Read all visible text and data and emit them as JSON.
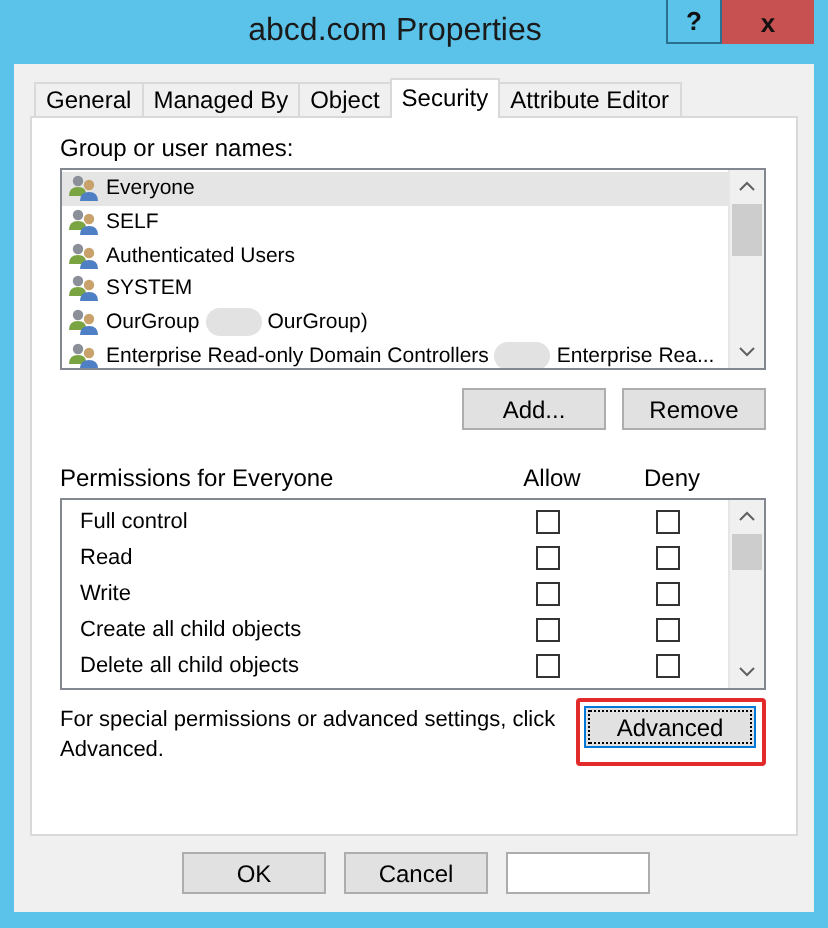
{
  "window": {
    "title": "abcd.com Properties",
    "help_button": "?",
    "close_button": "x"
  },
  "tabs": [
    {
      "label": "General",
      "selected": false
    },
    {
      "label": "Managed By",
      "selected": false
    },
    {
      "label": "Object",
      "selected": false
    },
    {
      "label": "Security",
      "selected": true
    },
    {
      "label": "Attribute Editor",
      "selected": false
    }
  ],
  "groups": {
    "label": "Group or user names:",
    "items": [
      {
        "name": "Everyone",
        "selected": true,
        "redacted": false
      },
      {
        "name": "SELF",
        "selected": false,
        "redacted": false
      },
      {
        "name": "Authenticated Users",
        "selected": false,
        "redacted": false
      },
      {
        "name": "SYSTEM",
        "selected": false,
        "redacted": false
      },
      {
        "name": "OurGroup",
        "name_tail": "OurGroup)",
        "selected": false,
        "redacted": true
      },
      {
        "name": "Enterprise Read-only Domain Controllers",
        "name_tail": "Enterprise Rea...",
        "selected": false,
        "redacted": true
      }
    ],
    "buttons": [
      "Add...",
      "Remove"
    ]
  },
  "permissions": {
    "label": "Permissions for Everyone",
    "columns": [
      "Allow",
      "Deny"
    ],
    "rows": [
      {
        "name": "Full control",
        "allow": false,
        "deny": false
      },
      {
        "name": "Read",
        "allow": false,
        "deny": false
      },
      {
        "name": "Write",
        "allow": false,
        "deny": false
      },
      {
        "name": "Create all child objects",
        "allow": false,
        "deny": false
      },
      {
        "name": "Delete all child objects",
        "allow": false,
        "deny": false
      }
    ]
  },
  "advanced": {
    "note": "For special permissions or advanced settings, click Advanced.",
    "button": "Advanced",
    "highlighted": true
  },
  "footer_buttons": [
    "OK",
    "Cancel"
  ]
}
